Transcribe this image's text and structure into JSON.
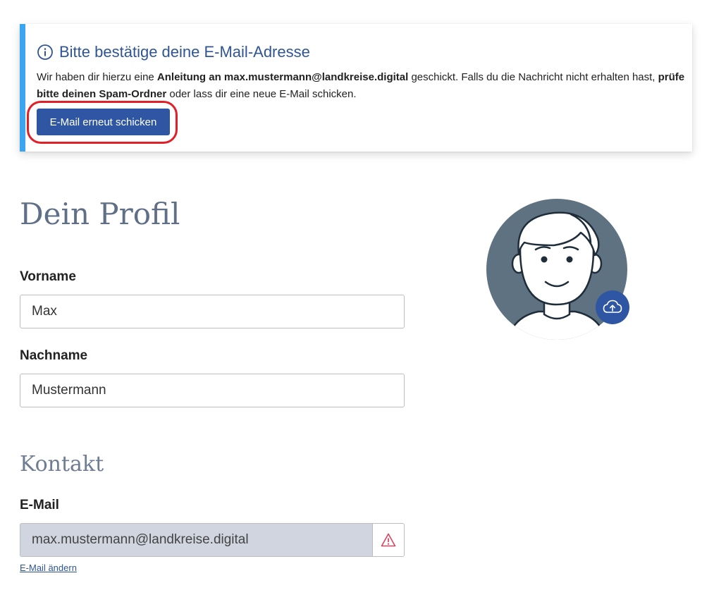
{
  "alert": {
    "title": "Bitte bestätige deine E-Mail-Adresse",
    "text_1": "Wir haben dir hierzu eine ",
    "text_bold_1": "Anleitung an max.mustermann@landkreise.digital",
    "text_2": " geschickt. Falls du die Nachricht nicht erhalten hast, ",
    "text_bold_2": "prüfe bitte deinen Spam-Ordner",
    "text_3": " oder lass dir eine neue E-Mail schicken.",
    "button_label": "E-Mail erneut schicken",
    "stripe_color": "#3aa5f0",
    "highlight_color": "#e01f26"
  },
  "profile": {
    "title": "Dein Profil",
    "first_name_label": "Vorname",
    "first_name_value": "Max",
    "last_name_label": "Nachname",
    "last_name_value": "Mustermann"
  },
  "contact": {
    "title": "Kontakt",
    "email_label": "E-Mail",
    "email_value": "max.mustermann@landkreise.digital",
    "change_email_link": "E-Mail ändern"
  },
  "avatar": {
    "icon": "avatar-placeholder",
    "upload_icon": "cloud-upload-icon"
  },
  "colors": {
    "primary": "#2f56a3",
    "heading": "#5f6f87",
    "warning": "#d9455f"
  }
}
